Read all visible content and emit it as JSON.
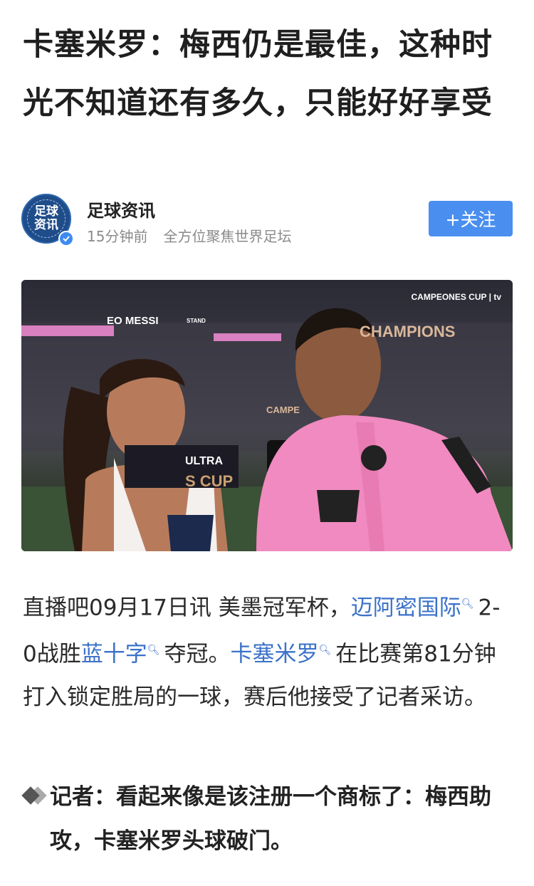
{
  "article": {
    "title": "卡塞米罗：梅西仍是最佳，这种时光不知道还有多久，只能好好享受"
  },
  "author": {
    "avatar_text": "足球资讯",
    "name": "足球资讯",
    "time": "15分钟前",
    "tagline": "全方位聚焦世界足坛",
    "follow_label": "+关注"
  },
  "photo": {
    "banner_messi": "EO MESSI",
    "banner_stand": "STAND",
    "banner_champions": "CHAMPIONS",
    "banner_ultra": "ULTRA",
    "banner_cup": "S CUP",
    "banner_campeones": "CAMPE",
    "corner_logo": "CAMPEONES CUP | tv"
  },
  "body": {
    "p1_a": "直播吧09月17日讯 美墨冠军杯，",
    "link1": "迈阿密国际",
    "p1_b": "2-0战胜",
    "link2": "蓝十字",
    "p1_c": "夺冠。",
    "link3": "卡塞米罗",
    "p1_d": "在比赛第81分钟打入锁定胜局的一球，赛后他接受了记者采访。",
    "quote": "记者：看起来像是该注册一个商标了：梅西助攻，卡塞米罗头球破门。"
  },
  "colors": {
    "link": "#3b72c9",
    "follow_button": "#4a8ff0",
    "jersey_pink": "#f08ac0"
  },
  "icons": {
    "search_link": "search-icon",
    "verified": "verified-check-icon",
    "quote": "diamond-bullet-icon"
  }
}
